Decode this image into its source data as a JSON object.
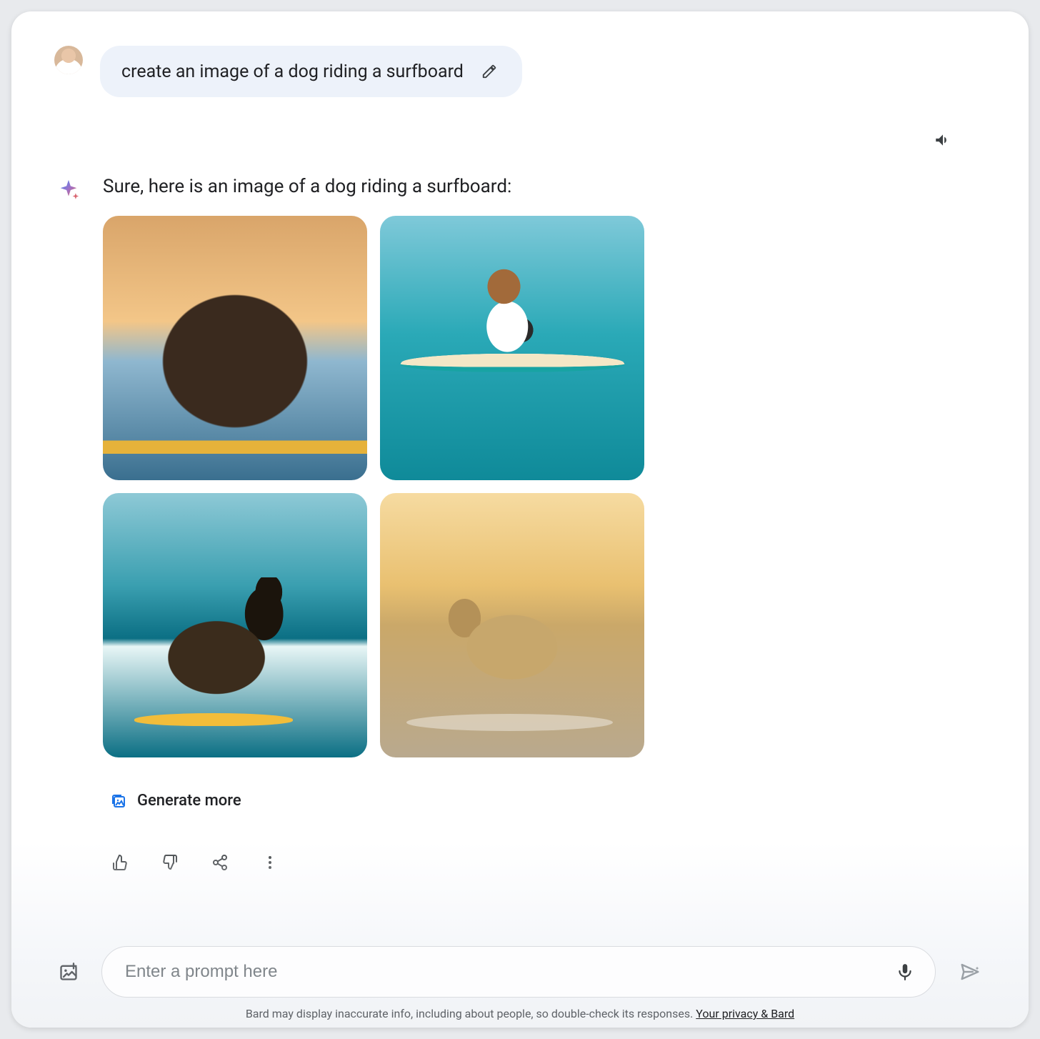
{
  "user": {
    "prompt_text": "create an image of a dog riding a surfboard"
  },
  "assistant": {
    "intro_text": "Sure, here is an image of a dog riding a surfboard:",
    "generate_more_label": "Generate more",
    "images": [
      {
        "alt": "Chocolate labrador on a surfboard at sunset"
      },
      {
        "alt": "Beagle with sunglasses standing on a surfboard on calm ocean"
      },
      {
        "alt": "German shepherd surfing a wave"
      },
      {
        "alt": "Golden labrador on a board at sunset shoreline"
      }
    ]
  },
  "input": {
    "placeholder": "Enter a prompt here"
  },
  "footer": {
    "disclaimer_text": "Bard may display inaccurate info, including about people, so double-check its responses. ",
    "privacy_link_label": "Your privacy & Bard"
  }
}
